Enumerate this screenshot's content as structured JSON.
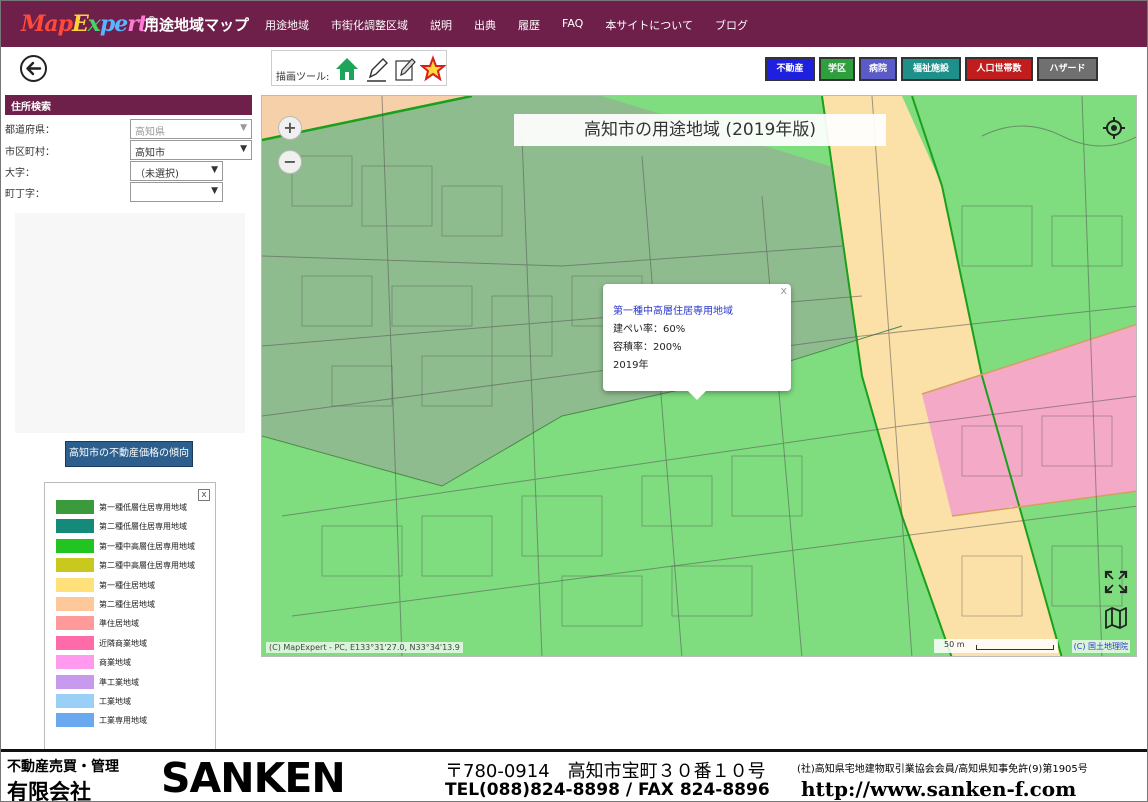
{
  "header": {
    "logo": {
      "p1": "Map",
      "p2": "E",
      "p3": "x",
      "p4": "pe",
      "p5": "rt",
      "reg": "®"
    },
    "title": "用途地域マップ",
    "nav": [
      "用途地域",
      "市街化調整区域",
      "説明",
      "出典",
      "履歴",
      "FAQ",
      "本サイトについて",
      "ブログ"
    ]
  },
  "draw_tools": {
    "label": "描画ツール:",
    "icons": [
      "house-icon",
      "pen-icon",
      "pencil-icon",
      "star-icon"
    ]
  },
  "categories": [
    {
      "label": "不動産",
      "color": "#1f1fe0"
    },
    {
      "label": "学区",
      "color": "#2e9e3e"
    },
    {
      "label": "病院",
      "color": "#5a5ac8"
    },
    {
      "label": "福祉施設",
      "color": "#1f8f8a"
    },
    {
      "label": "人口世帯数",
      "color": "#c01e1e"
    },
    {
      "label": "ハザード",
      "color": "#707070"
    }
  ],
  "sidebar": {
    "heading": "住所検索",
    "prefecture_label": "都道府県：",
    "prefecture_value": "高知県",
    "city_label": "市区町村：",
    "city_value": "高知市",
    "oaza_label": "大字：",
    "oaza_value": "（未選択)",
    "chome_label": "町丁字：",
    "chome_value": "",
    "trend_button": "高知市の不動産価格の傾向"
  },
  "legend": {
    "close": "x",
    "items": [
      {
        "label": "第一種低層住居専用地域",
        "color": "#3b9a3b"
      },
      {
        "label": "第二種低層住居専用地域",
        "color": "#158a7a"
      },
      {
        "label": "第一種中高層住居専用地域",
        "color": "#22c422"
      },
      {
        "label": "第二種中高層住居専用地域",
        "color": "#c8c81e"
      },
      {
        "label": "第一種住居地域",
        "color": "#ffe07a"
      },
      {
        "label": "第二種住居地域",
        "color": "#ffc89a"
      },
      {
        "label": "準住居地域",
        "color": "#ff9a9a"
      },
      {
        "label": "近隣商業地域",
        "color": "#ff6aa8"
      },
      {
        "label": "商業地域",
        "color": "#ff9aee"
      },
      {
        "label": "準工業地域",
        "color": "#c89aee"
      },
      {
        "label": "工業地域",
        "color": "#9ad0f8"
      },
      {
        "label": "工業専用地域",
        "color": "#6aa8f0"
      }
    ]
  },
  "map": {
    "title": "高知市の用途地域 (2019年版)",
    "zoom_in": "+",
    "zoom_out": "−",
    "popup": {
      "zone": "第一種中高層住居専用地域",
      "coverage": "建ぺい率：60%",
      "far": "容積率：200%",
      "year": "2019年",
      "close": "x"
    },
    "attribution": "(C) MapExpert - PC, E133°31'27.0, N33°34'13.9",
    "scale": "50 m",
    "gsi": "(C) 国土地理院"
  },
  "footer": {
    "line1": "不動産売買・管理",
    "line2": "有限会社",
    "brand": "SANKEN",
    "address": "〒780-0914　高知市宝町３０番１０号",
    "tel": "TEL(088)824-8898 / FAX 824-8896",
    "assoc": "(社)高知県宅地建物取引業協会会員/高知県知事免許(9)第1905号",
    "url": "http://www.sanken-f.com"
  }
}
